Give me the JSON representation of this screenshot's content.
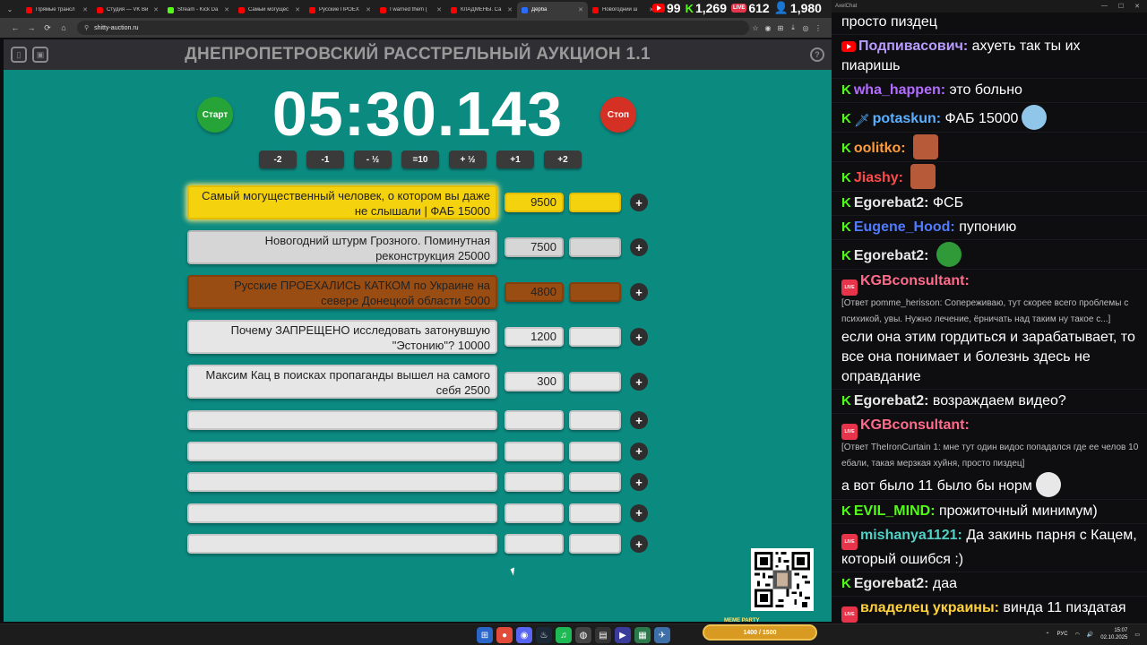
{
  "browser": {
    "tabs": [
      {
        "label": "Прямые трансл",
        "color": "#ff0000",
        "active": false
      },
      {
        "label": "Студия — VK Ви",
        "color": "#ff0000",
        "active": false
      },
      {
        "label": "Stream - Kick Da",
        "color": "#53fc18",
        "active": false
      },
      {
        "label": "Самый могущес",
        "color": "#ff0000",
        "active": false
      },
      {
        "label": "Русские ПРОЕХ",
        "color": "#ff0000",
        "active": false
      },
      {
        "label": "I warned them (",
        "color": "#ff0000",
        "active": false
      },
      {
        "label": "КЛАДМЕНЫ. Са",
        "color": "#ff0000",
        "active": false
      },
      {
        "label": "Дерба",
        "color": "#2b6cff",
        "active": true
      },
      {
        "label": "Новогодний ш",
        "color": "#ff0000",
        "active": false
      }
    ],
    "url": "shitty-auction.ru"
  },
  "stream_stats": {
    "youtube": "99",
    "kick": "1,269",
    "vk": "612",
    "total": "1,980"
  },
  "app": {
    "title": "ДНЕПРОПЕТРОВСКИЙ РАССТРЕЛЬНЫЙ АУКЦИОН 1.1",
    "start_label": "Старт",
    "stop_label": "Стоп",
    "timer": "05:30.143",
    "adjust_buttons": [
      "-2",
      "-1",
      "- ½",
      "=10",
      "+ ½",
      "+1",
      "+2"
    ],
    "lots": [
      {
        "name": "Самый могущественный человек, о котором вы даже не слышали | ФАБ 15000",
        "amount": "9500",
        "style": "gold"
      },
      {
        "name": "Новогодний штурм Грозного. Поминутная реконструкция 25000",
        "amount": "7500",
        "style": "silver"
      },
      {
        "name": "Русские ПРОЕХАЛИСЬ КАТКОМ по Украине на севере Донецкой области 5000",
        "amount": "4800",
        "style": "bronze"
      },
      {
        "name": "Почему ЗАПРЕЩЕНО исследовать затонувшую \"Эстонию\"? 10000",
        "amount": "1200",
        "style": "plain"
      },
      {
        "name": "Максим Кац в поисках пропаганды вышел на самого себя 2500",
        "amount": "300",
        "style": "plain"
      }
    ],
    "empty_rows": 5,
    "plus_label": "+"
  },
  "chat": {
    "window_title": "AxelChat",
    "messages": [
      {
        "badge": "",
        "nick": "",
        "color": "#ffffff",
        "text": "просто пиздец",
        "reply": ""
      },
      {
        "badge": "yt",
        "nick": "Подпивасович:",
        "color": "#b99cff",
        "text": "ахуеть так ты их пиаришь",
        "reply": ""
      },
      {
        "badge": "kick",
        "nick": "wha_happen:",
        "color": "#b36cff",
        "text": "это больно",
        "reply": ""
      },
      {
        "badge": "kick",
        "nick": "potaskun:",
        "color": "#5ab0ff",
        "text": "ФАБ 15000",
        "reply": ""
      },
      {
        "badge": "kick",
        "nick": "oolitko:",
        "color": "#ff9b3d",
        "text": "",
        "reply": ""
      },
      {
        "badge": "kick",
        "nick": "Jiashy:",
        "color": "#ff4a4a",
        "text": "",
        "reply": ""
      },
      {
        "badge": "kick",
        "nick": "Egorebat2:",
        "color": "#e8e8e8",
        "text": "ФСБ",
        "reply": ""
      },
      {
        "badge": "kick",
        "nick": "Eugene_Hood:",
        "color": "#4f7bff",
        "text": "пупонию",
        "reply": ""
      },
      {
        "badge": "kick",
        "nick": "Egorebat2:",
        "color": "#e8e8e8",
        "text": "",
        "reply": ""
      },
      {
        "badge": "live",
        "nick": "KGBconsultant:",
        "color": "#ff6b8a",
        "text": "если она этим гордиться и зарабатывает, то все она понимает и болезнь здесь не оправдание",
        "reply": "[Ответ pomme_herisson: Сопереживаю, тут скорее всего проблемы с психикой, увы. Нужно лечение, ёрничать над таким ну такое с...]"
      },
      {
        "badge": "kick",
        "nick": "Egorebat2:",
        "color": "#e8e8e8",
        "text": "возраждаем видео?",
        "reply": ""
      },
      {
        "badge": "live",
        "nick": "KGBconsultant:",
        "color": "#ff6b8a",
        "text": "а вот было 11 было бы норм",
        "reply": "[Ответ TheIronCurtain 1: мне тут один видос попадался где ее челов 10 ебали, такая мерзкая хуйня, просто пиздец]"
      },
      {
        "badge": "kick",
        "nick": "EVIL_MIND:",
        "color": "#53fc18",
        "text": "прожиточный минимум)",
        "reply": ""
      },
      {
        "badge": "live",
        "nick": "mishanya1121:",
        "color": "#4fd1c5",
        "text": "Да закинь парня с Кацем, который ошибся :)",
        "reply": ""
      },
      {
        "badge": "kick",
        "nick": "Egorebat2:",
        "color": "#e8e8e8",
        "text": "даа",
        "reply": ""
      },
      {
        "badge": "live",
        "nick": "владелец украины:",
        "color": "#ffd23c",
        "text": "винда 11 пиздатая",
        "reply": ""
      }
    ]
  },
  "taskbar": {
    "meme_label": "MEME PARTY",
    "meme_progress": "1400 / 1500",
    "lang": "РУС",
    "time": "15:07",
    "date": "02.10.2025"
  }
}
